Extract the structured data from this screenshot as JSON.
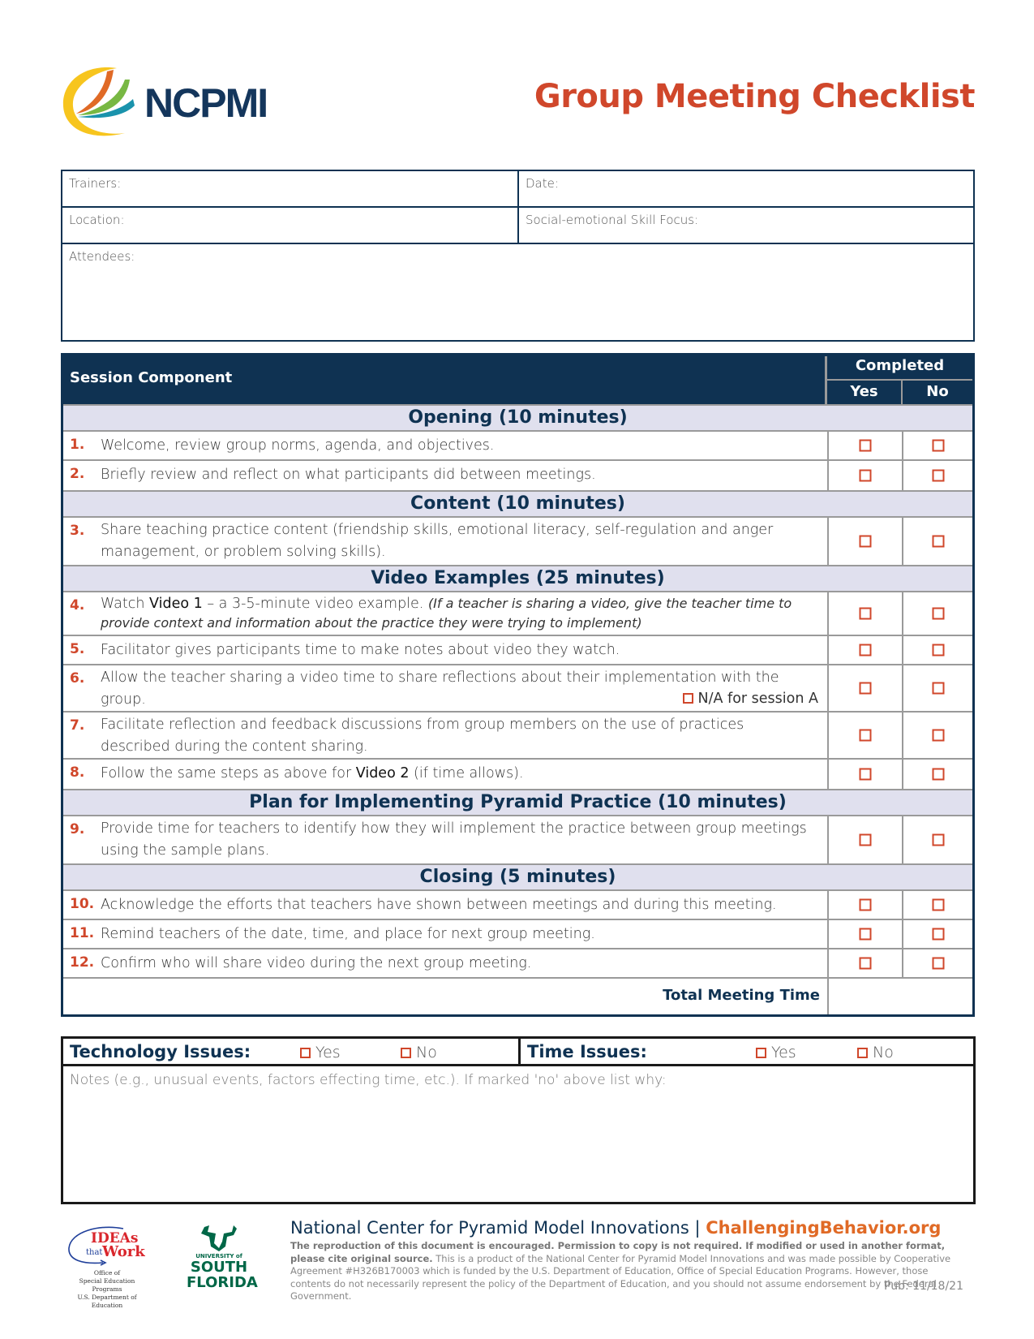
{
  "header": {
    "logo_text": "NCPMI",
    "title": "Group Meeting Checklist"
  },
  "info": {
    "trainers": "Trainers:",
    "date": "Date:",
    "location": "Location:",
    "skill_focus": "Social-emotional Skill Focus:",
    "attendees": "Attendees:"
  },
  "table": {
    "col_component": "Session Component",
    "col_completed": "Completed",
    "col_yes": "Yes",
    "col_no": "No",
    "sections": [
      {
        "title": "Opening (10 minutes)"
      },
      {
        "title": "Content (10 minutes)"
      },
      {
        "title": "Video Examples (25 minutes)"
      },
      {
        "title": "Plan for Implementing Pyramid Practice (10 minutes)"
      },
      {
        "title": "Closing (5 minutes)"
      }
    ],
    "items": [
      {
        "num": "1.",
        "text": "Welcome, review group norms, agenda, and objectives."
      },
      {
        "num": "2.",
        "text": "Briefly review and reflect on what participants did between meetings."
      },
      {
        "num": "3.",
        "text": "Share teaching practice content (friendship skills, emotional literacy, self-regulation and anger management, or problem solving skills)."
      },
      {
        "num": "4.",
        "pre": "Watch ",
        "bold": "Video 1",
        "post": " – a 3-5-minute video example. ",
        "italic": "(If a teacher is sharing a video, give the teacher time to provide context and information about the practice they were trying to implement)"
      },
      {
        "num": "5.",
        "text": "Facilitator gives participants time to make notes about video they watch."
      },
      {
        "num": "6.",
        "text": "Allow the teacher sharing a video time to share reflections about their implementation with the group.",
        "na_label": "N/A for session A"
      },
      {
        "num": "7.",
        "text": "Facilitate reflection and feedback discussions from group members on the use of practices described during the content sharing."
      },
      {
        "num": "8.",
        "pre": "Follow the same steps as above for ",
        "bold": "Video 2",
        "post": " (if time allows)."
      },
      {
        "num": "9.",
        "text": "Provide time for teachers to identify how they will implement the practice between group meetings using the sample plans."
      },
      {
        "num": "10.",
        "text": "Acknowledge the efforts that teachers have shown between meetings and during this meeting."
      },
      {
        "num": "11.",
        "text": "Remind teachers of the date, time, and place for next group meeting."
      },
      {
        "num": "12.",
        "text": "Confirm who will share video during the next group meeting."
      }
    ],
    "total_label": "Total Meeting Time"
  },
  "issues": {
    "tech_label": "Technology Issues:",
    "time_label": "Time Issues:",
    "yes": "Yes",
    "no": "No",
    "notes_label": "Notes (e.g., unusual events, factors effecting time, etc.). If marked 'no' above list why:"
  },
  "footer": {
    "org": "National Center for Pyramid Model Innovations | ",
    "link": "ChallengingBehavior.org",
    "fine_bold": "The reproduction of this document is encouraged. Permission to copy is not required. If modified or used in another format, please cite original source.",
    "fine_text": " This is a product of the National Center for Pyramid Model Innovations and was made possible by Cooperative Agreement #H326B170003 which is funded by the U.S. Department of Education, Office of Special Education Programs. However, those contents do not necessarily represent the policy of the Department of Education, and you should not assume endorsement by the Federal Government.",
    "pub": "Pub: 11/18/21",
    "ideas_line1": "IDEAs",
    "ideas_line2": "that",
    "ideas_line3": "Work",
    "ideas_sub1": "Office of",
    "ideas_sub2": "Special Education Programs",
    "ideas_sub3": "U.S. Department of Education",
    "usf_small": "UNIVERSITY of",
    "usf_line1": "SOUTH",
    "usf_line2": "FLORIDA"
  }
}
